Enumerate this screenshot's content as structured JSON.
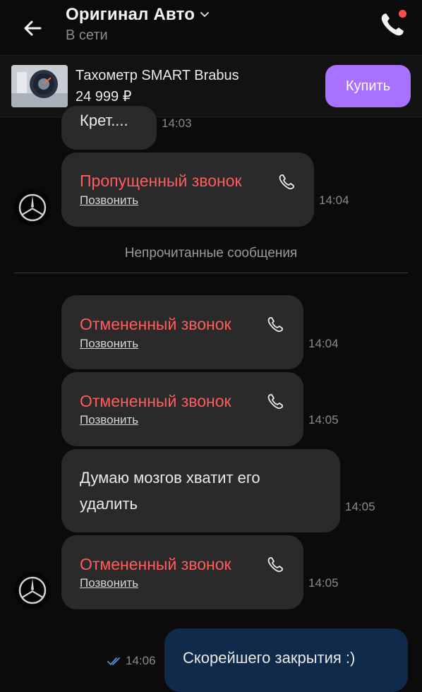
{
  "header": {
    "title": "Оригинал Авто",
    "status": "В сети"
  },
  "product": {
    "name": "Тахометр SMART Brabus",
    "price": "24 999 ₽",
    "buy_label": "Купить"
  },
  "messages": {
    "partial_text": "Крет....",
    "partial_time": "14:03",
    "missed_call_title": "Пропущенный звонок",
    "missed_call_action": "Позвонить",
    "missed_call_time": "14:04",
    "unread_divider": "Непрочитанные сообщения",
    "cancel1_title": "Отмененный звонок",
    "cancel1_action": "Позвонить",
    "cancel1_time": "14:04",
    "cancel2_title": "Отмененный звонок",
    "cancel2_action": "Позвонить",
    "cancel2_time": "14:05",
    "text_line1": "Думаю мозгов хватит его",
    "text_line2": "удалить",
    "text_time": "14:05",
    "cancel3_title": "Отмененный звонок",
    "cancel3_action": "Позвонить",
    "cancel3_time": "14:05",
    "outgoing_text": "Скорейшего закрытия :)",
    "outgoing_time": "14:06"
  },
  "colors": {
    "accent": "#a971ff",
    "missed": "#ff5c5c",
    "notification_dot": "#ff4b4b"
  }
}
